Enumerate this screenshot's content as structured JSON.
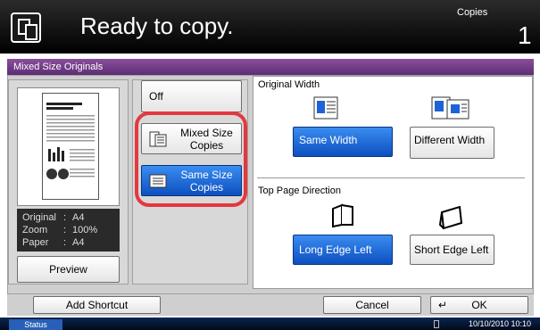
{
  "header": {
    "title": "Ready to copy.",
    "copies_label": "Copies",
    "copies_count": "1"
  },
  "title_bar": "Mixed Size Originals",
  "preview": {
    "rows": [
      {
        "key": "Original",
        "value": "A4"
      },
      {
        "key": "Zoom",
        "value": "100%"
      },
      {
        "key": "Paper",
        "value": "A4"
      }
    ],
    "preview_button": "Preview"
  },
  "options": {
    "off": "Off",
    "mixed_size": "Mixed Size Copies",
    "same_size": "Same Size Copies"
  },
  "original_width": {
    "label": "Original Width",
    "same": "Same Width",
    "different": "Different Width"
  },
  "top_page": {
    "label": "Top Page Direction",
    "long_edge": "Long Edge Left",
    "short_edge": "Short Edge Left"
  },
  "footer": {
    "add_shortcut": "Add Shortcut",
    "cancel": "Cancel",
    "ok": "OK"
  },
  "status": {
    "button": "Status",
    "datetime": "10/10/2010  10:10"
  },
  "colors": {
    "selected_blue": "#1e63d6",
    "highlight_red": "#e3383f",
    "title_purple": "#6b3a84"
  }
}
